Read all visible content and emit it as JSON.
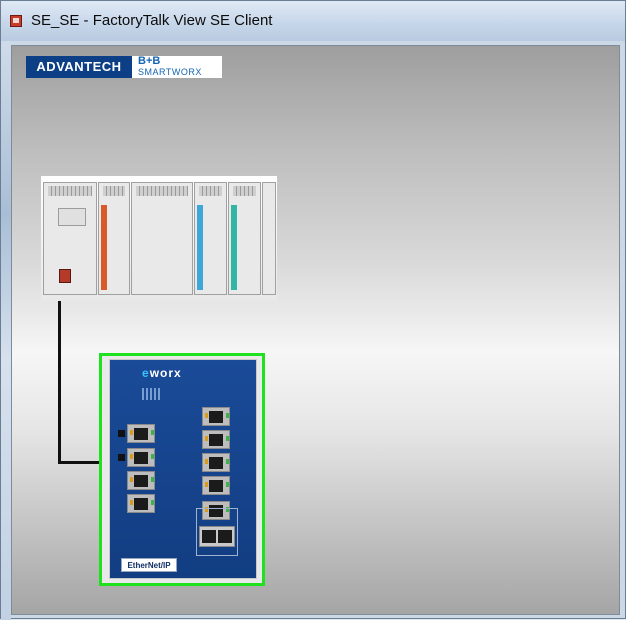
{
  "window": {
    "title": "SE_SE - FactoryTalk View SE Client"
  },
  "logo": {
    "advantech": "ADVANTECH",
    "bb": "B+B",
    "smartworx": "SMARTWORX"
  },
  "switch": {
    "brand": "eworx",
    "ethernetip": "EtherNet/IP"
  },
  "icons": {
    "window": "app-window-icon",
    "plc": "plc-rack-image",
    "switch": "ethernet-switch-image"
  },
  "colors": {
    "selection_border": "#1ee21e",
    "switch_body": "#1a4b98",
    "advantech_blue": "#0c3f86",
    "cable": "#101010"
  }
}
